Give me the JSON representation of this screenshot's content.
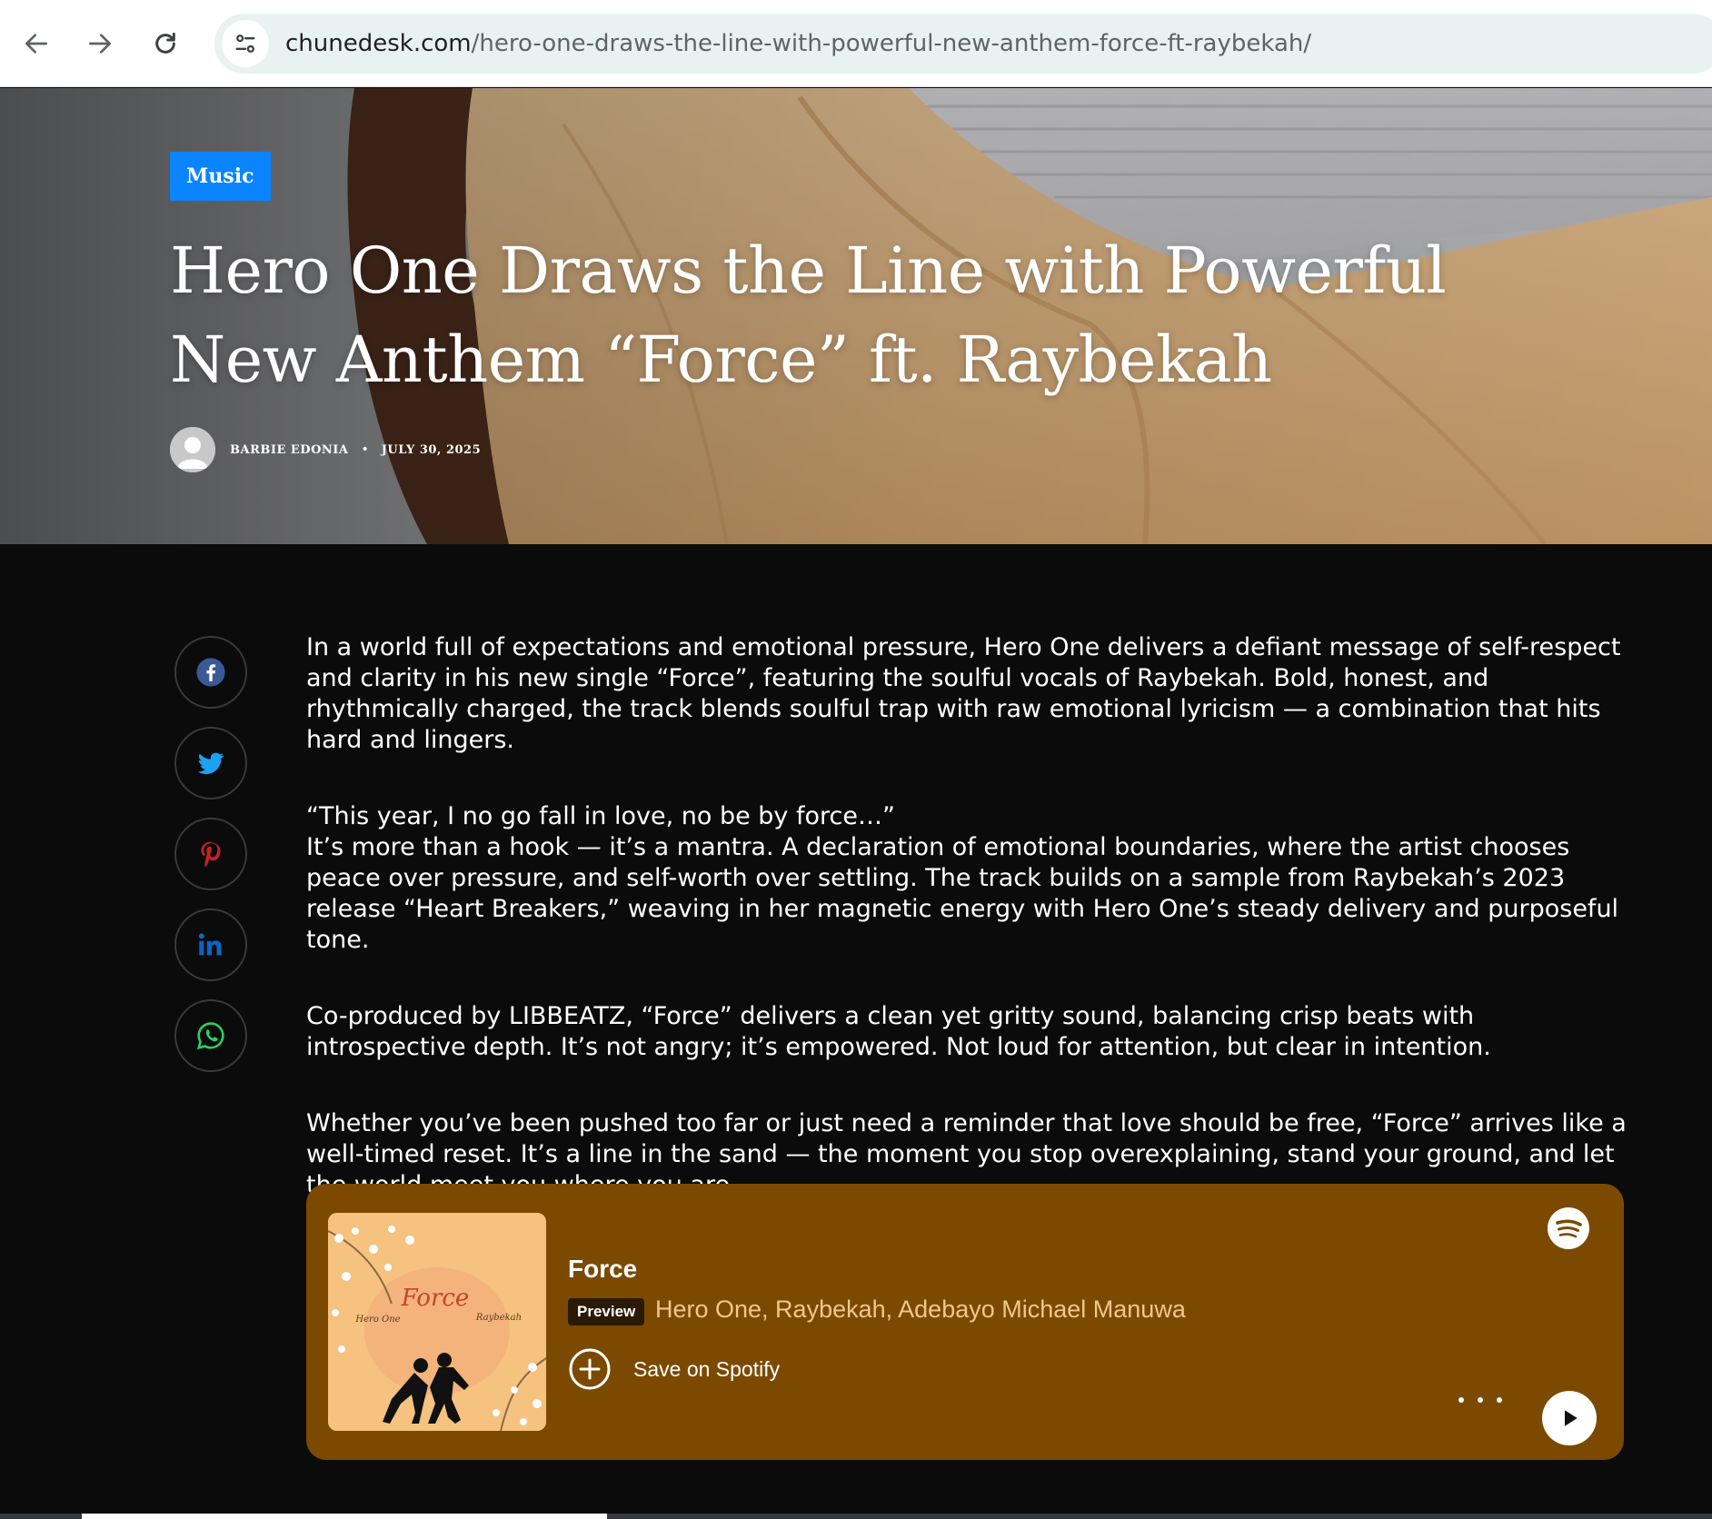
{
  "browser": {
    "url_domain": "chunedesk.com",
    "url_path": "/hero-one-draws-the-line-with-powerful-new-anthem-force-ft-raybekah/",
    "back_icon": "arrow-left-icon",
    "forward_icon": "arrow-right-icon",
    "reload_icon": "reload-icon",
    "site_info_icon": "tune-icon"
  },
  "hero": {
    "category": "Music",
    "title": "Hero One Draws the Line with Powerful New Anthem “Force” ft. Raybekah",
    "author": "BARBIE EDONIA",
    "date": "JULY 30, 2025"
  },
  "share": [
    {
      "name": "facebook",
      "icon": "facebook-icon",
      "color": "#3b5998"
    },
    {
      "name": "twitter",
      "icon": "twitter-icon",
      "color": "#1da1f2"
    },
    {
      "name": "pinterest",
      "icon": "pinterest-icon",
      "color": "#cb2027"
    },
    {
      "name": "linkedin",
      "icon": "linkedin-icon",
      "color": "#0a66c2"
    },
    {
      "name": "whatsapp",
      "icon": "whatsapp-icon",
      "color": "#25d366"
    }
  ],
  "article": {
    "p1": "In a world full of expectations and emotional pressure, Hero One delivers a defiant message of self-respect and clarity in his new single “Force”, featuring the soulful vocals of Raybekah. Bold, honest, and rhythmically charged, the track blends soulful trap with raw emotional lyricism — a combination that hits hard and lingers.",
    "p2_quote": "“This year, I no go fall in love, no be by force…”",
    "p2_body": "It’s more than a hook — it’s a mantra. A declaration of emotional boundaries, where the artist chooses peace over pressure, and self-worth over settling. The track builds on a sample from Raybekah’s 2023 release “Heart Breakers,” weaving in her magnetic energy with Hero One’s steady delivery and purposeful tone.",
    "p3": "Co-produced by LIBBEATZ, “Force” delivers a clean yet gritty sound, balancing crisp beats with introspective depth. It’s not angry; it’s empowered. Not loud for attention, but clear in intention.",
    "p4": "Whether you’ve been pushed too far or just need a reminder that love should be free, “Force” arrives like a well-timed reset. It’s a line in the sand — the moment you stop overexplaining, stand your ground, and let the world meet you where you are."
  },
  "spotify": {
    "track_title": "Force",
    "preview_label": "Preview",
    "artists": "Hero One, Raybekah, Adebayo Michael Manuwa",
    "save_label": "Save on Spotify",
    "cover_title": "Force",
    "cover_left": "Hero One",
    "cover_right": "Raybekah",
    "background_color": "#7b4a00"
  }
}
